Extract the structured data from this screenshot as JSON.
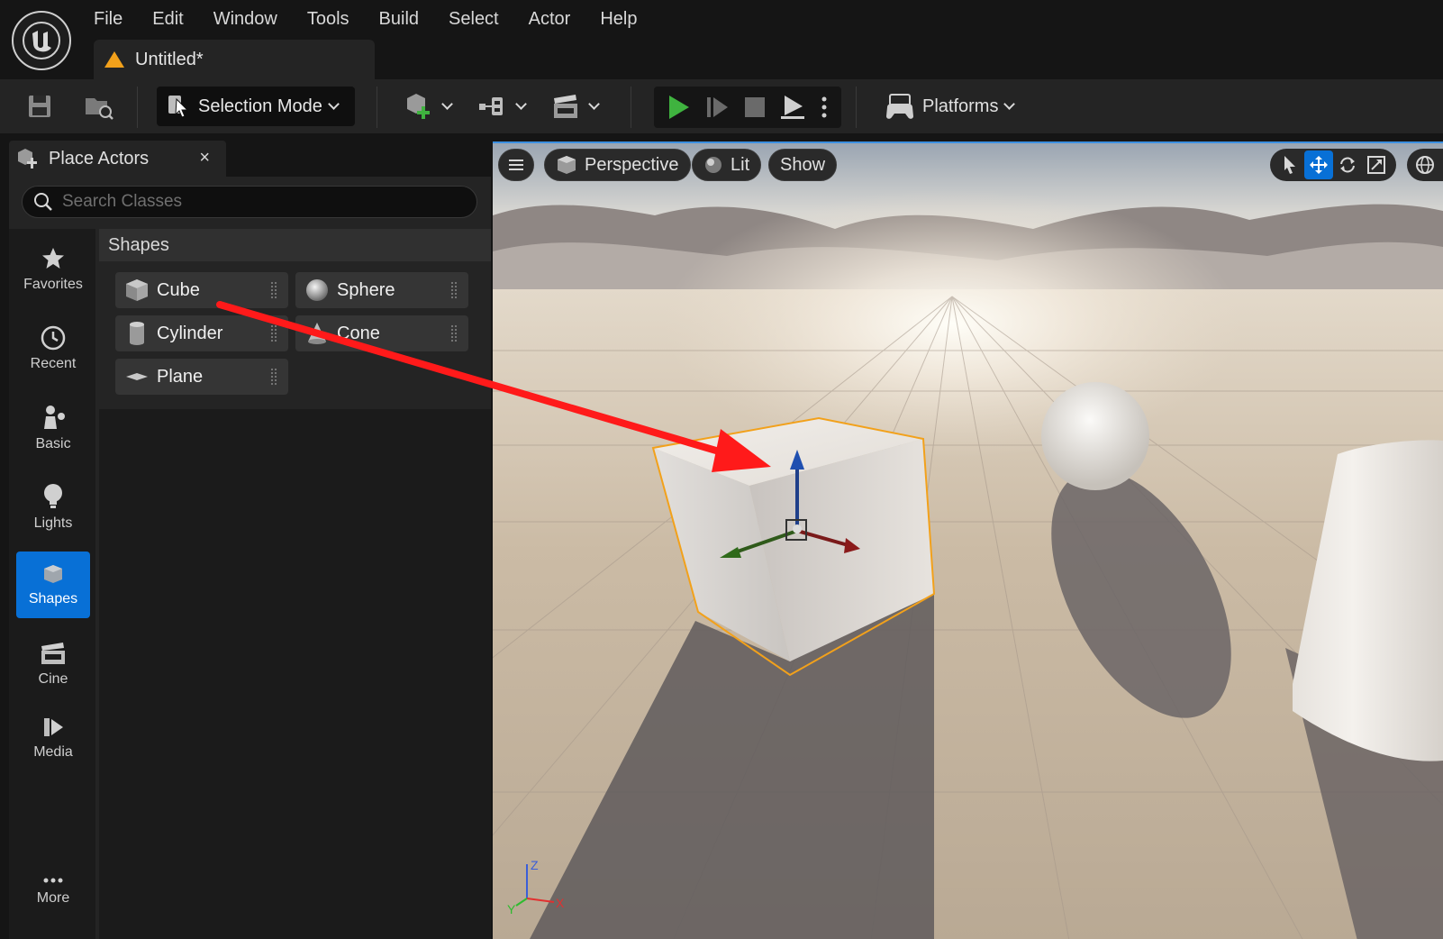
{
  "menu": [
    "File",
    "Edit",
    "Window",
    "Tools",
    "Build",
    "Select",
    "Actor",
    "Help"
  ],
  "document_tab": {
    "title": "Untitled*"
  },
  "toolbar": {
    "selection_mode": "Selection Mode",
    "platforms": "Platforms"
  },
  "place_actors": {
    "tab_label": "Place Actors",
    "close_glyph": "×",
    "search_placeholder": "Search Classes",
    "categories": [
      {
        "label": "Favorites",
        "icon": "star-icon"
      },
      {
        "label": "Recent",
        "icon": "clock-icon"
      },
      {
        "label": "Basic",
        "icon": "basic-actors-icon"
      },
      {
        "label": "Lights",
        "icon": "lightbulb-icon"
      },
      {
        "label": "Shapes",
        "icon": "cube-icon",
        "active": true
      },
      {
        "label": "Cine",
        "icon": "clapperboard-icon"
      },
      {
        "label": "Media",
        "icon": "media-icon"
      },
      {
        "label": "More",
        "icon": "more-icon"
      }
    ],
    "section_title": "Shapes",
    "shapes": [
      {
        "label": "Cube",
        "icon": "cube-icon"
      },
      {
        "label": "Sphere",
        "icon": "sphere-icon"
      },
      {
        "label": "Cylinder",
        "icon": "cylinder-icon"
      },
      {
        "label": "Cone",
        "icon": "cone-icon"
      },
      {
        "label": "Plane",
        "icon": "plane-icon"
      }
    ]
  },
  "viewport": {
    "perspective": "Perspective",
    "lit": "Lit",
    "show": "Show",
    "axes": {
      "z": "Z",
      "x": "X",
      "y": "Y"
    }
  },
  "colors": {
    "accent": "#0870d6",
    "selection_outline": "#f2a11b",
    "annotation_arrow": "#ff1a1a",
    "play_green": "#3fb33f"
  }
}
